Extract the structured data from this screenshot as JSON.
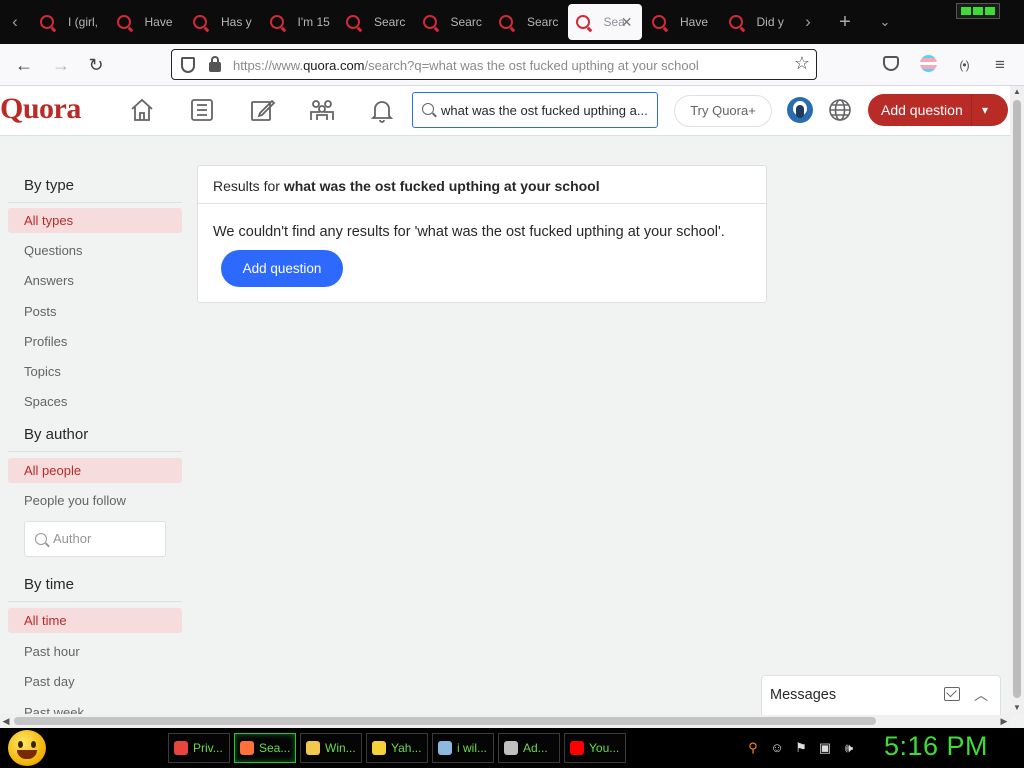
{
  "browser": {
    "tabs": [
      {
        "title": "I (girl,"
      },
      {
        "title": "Have"
      },
      {
        "title": "Has y"
      },
      {
        "title": "I'm 15"
      },
      {
        "title": "Searc"
      },
      {
        "title": "Searc"
      },
      {
        "title": "Searc"
      },
      {
        "title": "Sea",
        "active": true
      },
      {
        "title": "Have"
      },
      {
        "title": "Did y"
      }
    ],
    "url_prefix": "https://www.",
    "url_domain": "quora.com",
    "url_rest": "/search?q=what was the ost fucked upthing at your school"
  },
  "header": {
    "logo": "Quora",
    "search_value": "what was the ost fucked upthing a...",
    "try_button": "Try Quora+",
    "add_question": "Add question",
    "accent_color": "#b92b27"
  },
  "sidebar": {
    "by_type": {
      "heading": "By type",
      "items": [
        "All types",
        "Questions",
        "Answers",
        "Posts",
        "Profiles",
        "Topics",
        "Spaces"
      ],
      "selected": "All types"
    },
    "by_author": {
      "heading": "By author",
      "items": [
        "All people",
        "People you follow"
      ],
      "selected": "All people",
      "author_placeholder": "Author"
    },
    "by_time": {
      "heading": "By time",
      "items": [
        "All time",
        "Past hour",
        "Past day",
        "Past week"
      ],
      "selected": "All time"
    }
  },
  "results": {
    "prefix": "Results for ",
    "query": "what was the ost fucked upthing at your school",
    "message": "We couldn't find any results for 'what was the ost fucked upthing at your school'.",
    "button": "Add question",
    "button_color": "#2e69ff"
  },
  "messages": {
    "label": "Messages"
  },
  "taskbar": {
    "tasks": [
      {
        "label": "Priv...",
        "icon": "chrome-icon",
        "color": "#e8453c"
      },
      {
        "label": "Sea...",
        "icon": "firefox-icon",
        "color": "#ff7139",
        "active": true
      },
      {
        "label": "Win...",
        "icon": "folder-icon",
        "color": "#f2c94c"
      },
      {
        "label": "Yah...",
        "icon": "yahoo-smiley-icon",
        "color": "#f6d13a"
      },
      {
        "label": "i wil...",
        "icon": "notepad-icon",
        "color": "#8fb8e0"
      },
      {
        "label": "Ad...",
        "icon": "cmd-icon",
        "color": "#c0c0c0"
      },
      {
        "label": "You...",
        "icon": "youtube-icon",
        "color": "#ff0000"
      }
    ],
    "clock": "5:16 PM"
  }
}
